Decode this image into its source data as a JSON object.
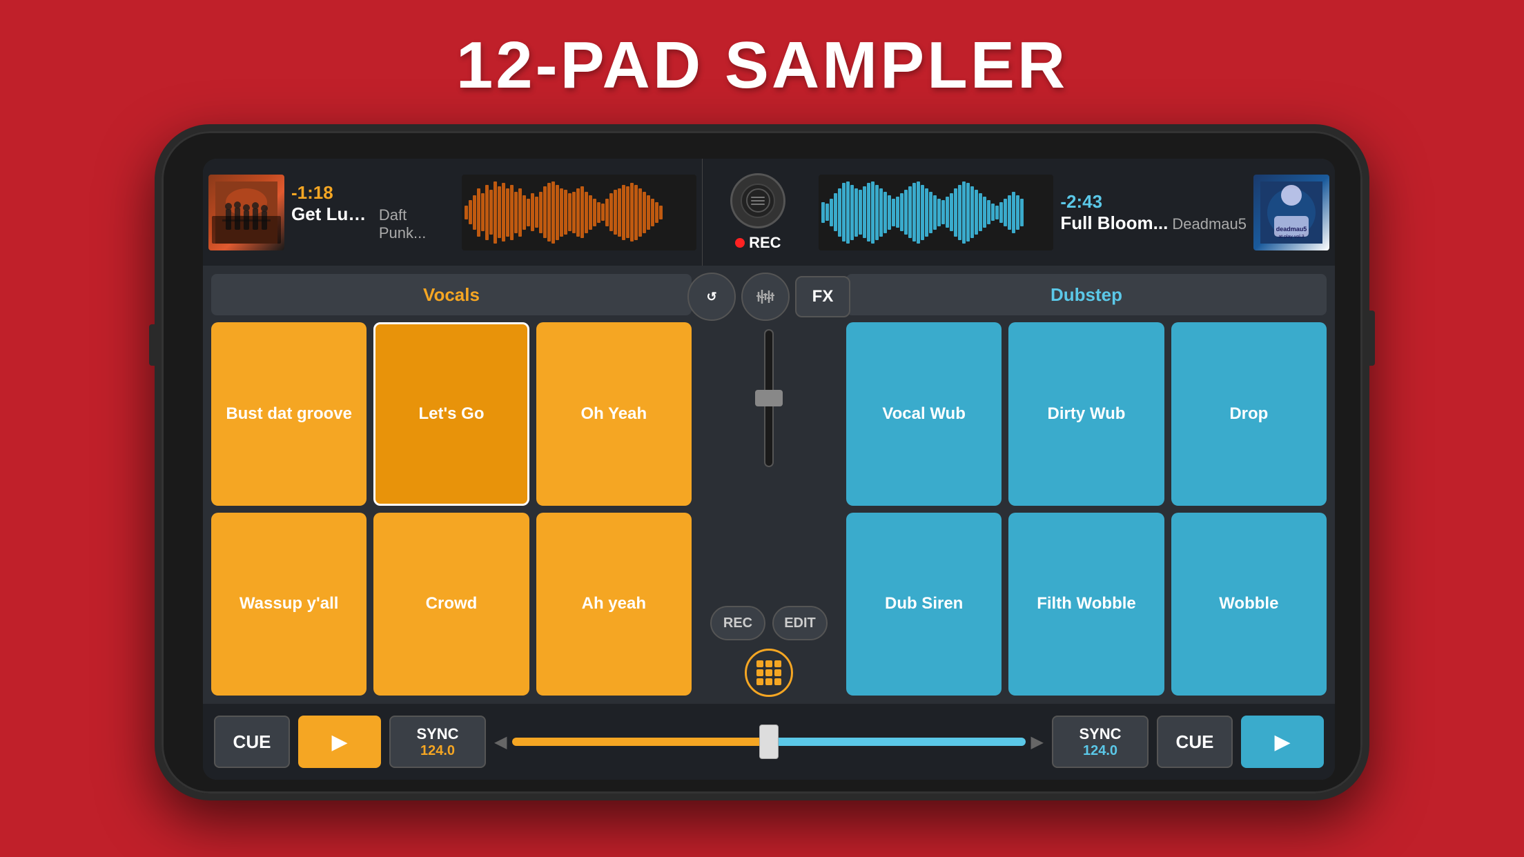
{
  "page": {
    "title": "12-PAD SAMPLER"
  },
  "track_left": {
    "time": "-1:18",
    "name": "Get Lucky",
    "artist": "Daft Punk..."
  },
  "track_right": {
    "time": "-2:43",
    "name": "Full Bloom...",
    "artist": "Deadmau5"
  },
  "rec_label": "REC",
  "left_deck": {
    "category": "Vocals",
    "pads": [
      {
        "label": "Bust dat groove",
        "active": false
      },
      {
        "label": "Let's Go",
        "active": true
      },
      {
        "label": "Oh Yeah",
        "active": false
      },
      {
        "label": "Wassup y'all",
        "active": false
      },
      {
        "label": "Crowd",
        "active": false
      },
      {
        "label": "Ah yeah",
        "active": false
      }
    ]
  },
  "right_deck": {
    "category": "Dubstep",
    "pads": [
      {
        "label": "Vocal Wub",
        "active": false
      },
      {
        "label": "Dirty Wub",
        "active": false
      },
      {
        "label": "Drop",
        "active": false
      },
      {
        "label": "Dub Siren",
        "active": false
      },
      {
        "label": "Filth Wobble",
        "active": false
      },
      {
        "label": "Wobble",
        "active": false
      }
    ]
  },
  "center": {
    "loop_icon": "↺",
    "eq_icon": "⊞",
    "fx_label": "FX",
    "rec_label": "REC",
    "edit_label": "EDIT"
  },
  "transport_left": {
    "cue_label": "CUE",
    "play_icon": "▶",
    "sync_label": "SYNC",
    "bpm": "124.0"
  },
  "transport_right": {
    "sync_label": "SYNC",
    "bpm": "124.0",
    "cue_label": "CUE",
    "play_icon": "▶"
  }
}
